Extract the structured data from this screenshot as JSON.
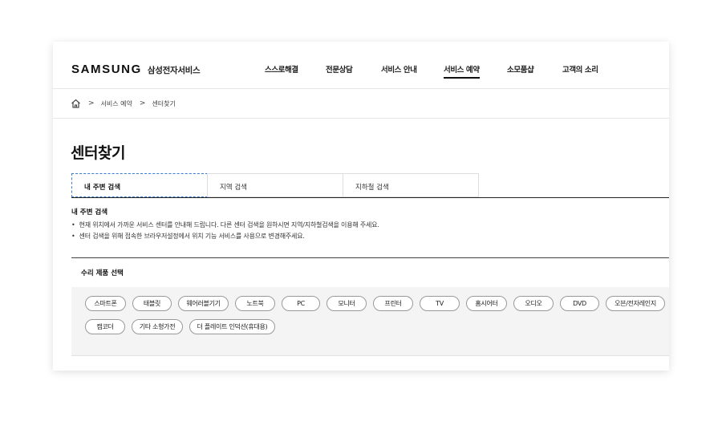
{
  "header": {
    "logo": "SAMSUNG",
    "logo_sub": "삼성전자서비스",
    "nav": [
      "스스로해결",
      "전문상담",
      "서비스 안내",
      "서비스 예약",
      "소모품샵",
      "고객의 소리"
    ],
    "active_nav": "서비스 예약"
  },
  "breadcrumb": {
    "home_icon": "home-icon",
    "items": [
      "서비스 예약",
      "센터찾기"
    ],
    "separator": ">"
  },
  "page": {
    "title": "센터찾기"
  },
  "tabs": [
    "내 주변 검색",
    "지역 검색",
    "지하철 검색"
  ],
  "active_tab": "내 주변 검색",
  "info": {
    "title": "내 주변 검색",
    "lines": [
      "현재 위치에서 가까운 서비스 센터를 안내해 드립니다. 다른 센터 검색을 원하시면 지역/지하철검색을 이용해 주세요.",
      "센터 검색을 위해 접속한 브라우저설정에서 위치 기능 서비스를 사용으로 변경해주세요."
    ]
  },
  "products": {
    "title": "수리 제품 선택",
    "items": [
      "스마트폰",
      "태블릿",
      "웨어러블기기",
      "노트북",
      "PC",
      "모니터",
      "프린터",
      "TV",
      "홈시어터",
      "오디오",
      "DVD",
      "오븐/전자레인지",
      "캠코더",
      "기타 소형가전",
      "더 플레이트 인덕션(휴대용)"
    ]
  },
  "colors": {
    "active_tab_border": "#3a7bd5",
    "chip_area_bg": "#f4f4f4"
  }
}
